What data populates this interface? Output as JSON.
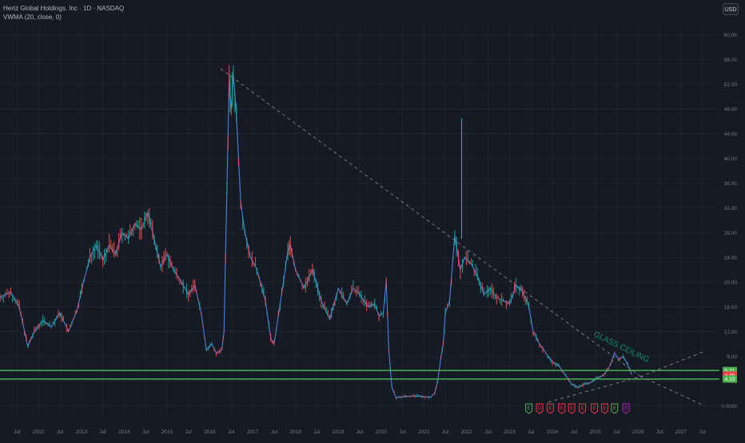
{
  "header": {
    "symbol_title": "Hertz Global Holdings, Inc · 1D · NASDAQ",
    "indicator_label": "VWMA (20, close, 0)",
    "currency_button": "USD"
  },
  "colors": {
    "background": "#161a25",
    "grid": "#1f2330",
    "axis_text": "#787b86",
    "price_line": "#4c7ee0",
    "candle_up": "#26a69a",
    "candle_down": "#ef5350",
    "support_band": "#4caf50",
    "trendline": "#787b86",
    "annotation": "#14896e",
    "badge_green": "#4caf50",
    "badge_red": "#f23645",
    "badge_purple": "#9c27b0"
  },
  "chart_data": {
    "type": "line",
    "title": "Hertz Global Holdings, Inc · 1D · NASDAQ",
    "xlabel": "",
    "ylabel": "",
    "xlim": [
      2011.1,
      2027.9
    ],
    "ylim": [
      -1.5,
      62
    ],
    "grid": true,
    "y_ticks": [
      0,
      4,
      8,
      12,
      16,
      20,
      24,
      28,
      32,
      36,
      40,
      44,
      48,
      52,
      56,
      60
    ],
    "y_tick_labels": [
      "0.0000",
      "4.00",
      "8.00",
      "12.00",
      "16.00",
      "20.00",
      "24.00",
      "28.00",
      "32.00",
      "36.00",
      "40.00",
      "44.00",
      "48.00",
      "52.00",
      "56.00",
      "60.00"
    ],
    "x_ticks": [
      {
        "x": 2011.5,
        "label": "Jul"
      },
      {
        "x": 2012.0,
        "label": "2012"
      },
      {
        "x": 2012.5,
        "label": "Jul"
      },
      {
        "x": 2013.0,
        "label": "2013"
      },
      {
        "x": 2013.5,
        "label": "Jul"
      },
      {
        "x": 2014.0,
        "label": "2014"
      },
      {
        "x": 2014.5,
        "label": "Jul"
      },
      {
        "x": 2015.0,
        "label": "2015"
      },
      {
        "x": 2015.5,
        "label": "Jul"
      },
      {
        "x": 2016.0,
        "label": "2016"
      },
      {
        "x": 2016.5,
        "label": "Jul"
      },
      {
        "x": 2017.0,
        "label": "2017"
      },
      {
        "x": 2017.5,
        "label": "Jul"
      },
      {
        "x": 2018.0,
        "label": "2018"
      },
      {
        "x": 2018.5,
        "label": "Jul"
      },
      {
        "x": 2019.0,
        "label": "2019"
      },
      {
        "x": 2019.5,
        "label": "Jul"
      },
      {
        "x": 2020.0,
        "label": "2020"
      },
      {
        "x": 2020.5,
        "label": "Jul"
      },
      {
        "x": 2021.0,
        "label": "2021"
      },
      {
        "x": 2021.5,
        "label": "Jul"
      },
      {
        "x": 2022.0,
        "label": "2022"
      },
      {
        "x": 2022.5,
        "label": "Jul"
      },
      {
        "x": 2023.0,
        "label": "2023"
      },
      {
        "x": 2023.5,
        "label": "Jul"
      },
      {
        "x": 2024.0,
        "label": "2024"
      },
      {
        "x": 2024.5,
        "label": "Jul"
      },
      {
        "x": 2025.0,
        "label": "2025"
      },
      {
        "x": 2025.5,
        "label": "Jul"
      },
      {
        "x": 2026.0,
        "label": "2026"
      },
      {
        "x": 2026.5,
        "label": "Jul"
      },
      {
        "x": 2027.0,
        "label": "2027"
      },
      {
        "x": 2027.5,
        "label": "Jul"
      }
    ],
    "series": [
      {
        "points": [
          [
            2011.1,
            17.5
          ],
          [
            2011.35,
            18.4
          ],
          [
            2011.55,
            16.0
          ],
          [
            2011.75,
            9.6
          ],
          [
            2011.9,
            12.0
          ],
          [
            2012.1,
            13.8
          ],
          [
            2012.3,
            12.8
          ],
          [
            2012.5,
            15.0
          ],
          [
            2012.7,
            12.0
          ],
          [
            2012.9,
            15.5
          ],
          [
            2013.05,
            20.0
          ],
          [
            2013.2,
            24.0
          ],
          [
            2013.35,
            26.0
          ],
          [
            2013.5,
            23.5
          ],
          [
            2013.65,
            26.0
          ],
          [
            2013.8,
            24.5
          ],
          [
            2013.95,
            28.0
          ],
          [
            2014.1,
            27.0
          ],
          [
            2014.25,
            29.5
          ],
          [
            2014.4,
            28.5
          ],
          [
            2014.55,
            31.3
          ],
          [
            2014.7,
            27.0
          ],
          [
            2014.85,
            22.5
          ],
          [
            2015.0,
            24.5
          ],
          [
            2015.15,
            22.0
          ],
          [
            2015.3,
            20.5
          ],
          [
            2015.5,
            18.0
          ],
          [
            2015.65,
            19.5
          ],
          [
            2015.8,
            15.0
          ],
          [
            2015.92,
            9.0
          ],
          [
            2016.05,
            10.0
          ],
          [
            2016.15,
            8.5
          ],
          [
            2016.28,
            9.0
          ],
          [
            2016.33,
            12.0
          ],
          [
            2016.4,
            35.0
          ],
          [
            2016.45,
            52.5
          ],
          [
            2016.5,
            48.0
          ],
          [
            2016.55,
            53.5
          ],
          [
            2016.62,
            47.0
          ],
          [
            2016.72,
            33.0
          ],
          [
            2016.82,
            28.0
          ],
          [
            2016.95,
            24.0
          ],
          [
            2017.1,
            22.0
          ],
          [
            2017.3,
            17.0
          ],
          [
            2017.42,
            11.0
          ],
          [
            2017.5,
            10.0
          ],
          [
            2017.6,
            14.5
          ],
          [
            2017.72,
            20.0
          ],
          [
            2017.82,
            25.0
          ],
          [
            2017.88,
            26.0
          ],
          [
            2018.0,
            22.0
          ],
          [
            2018.2,
            19.0
          ],
          [
            2018.4,
            22.0
          ],
          [
            2018.6,
            17.0
          ],
          [
            2018.8,
            14.0
          ],
          [
            2019.0,
            19.0
          ],
          [
            2019.2,
            16.5
          ],
          [
            2019.35,
            19.0
          ],
          [
            2019.5,
            18.0
          ],
          [
            2019.7,
            16.0
          ],
          [
            2019.85,
            16.5
          ],
          [
            2019.95,
            14.5
          ],
          [
            2020.05,
            15.0
          ],
          [
            2020.12,
            20.2
          ],
          [
            2020.18,
            9.0
          ],
          [
            2020.25,
            3.0
          ],
          [
            2020.35,
            1.3
          ],
          [
            2020.55,
            1.5
          ],
          [
            2020.75,
            1.6
          ],
          [
            2020.95,
            1.5
          ],
          [
            2021.15,
            1.4
          ],
          [
            2021.25,
            2.0
          ],
          [
            2021.32,
            4.0
          ],
          [
            2021.4,
            8.0
          ],
          [
            2021.45,
            10.0
          ],
          [
            2021.5,
            15.0
          ],
          [
            2021.6,
            17.0
          ],
          [
            2021.72,
            27.5
          ],
          [
            2021.85,
            22.0
          ],
          [
            2021.95,
            24.0
          ],
          [
            2022.1,
            23.0
          ],
          [
            2022.25,
            21.0
          ],
          [
            2022.4,
            18.0
          ],
          [
            2022.55,
            19.0
          ],
          [
            2022.7,
            17.5
          ],
          [
            2022.85,
            17.0
          ],
          [
            2023.0,
            16.5
          ],
          [
            2023.15,
            19.5
          ],
          [
            2023.3,
            18.5
          ],
          [
            2023.45,
            16.0
          ],
          [
            2023.55,
            12.0
          ],
          [
            2023.7,
            10.0
          ],
          [
            2023.85,
            8.5
          ],
          [
            2024.0,
            7.0
          ],
          [
            2024.15,
            6.5
          ],
          [
            2024.3,
            5.0
          ],
          [
            2024.45,
            3.5
          ],
          [
            2024.6,
            3.0
          ],
          [
            2024.75,
            3.5
          ],
          [
            2024.9,
            3.8
          ],
          [
            2025.05,
            4.5
          ],
          [
            2025.2,
            5.0
          ],
          [
            2025.35,
            6.5
          ],
          [
            2025.45,
            8.5
          ],
          [
            2025.55,
            7.5
          ],
          [
            2025.65,
            8.0
          ],
          [
            2025.72,
            7.2
          ],
          [
            2025.8,
            6.0
          ],
          [
            2025.85,
            5.0
          ]
        ]
      }
    ],
    "spikes": [
      {
        "x": 2021.88,
        "low": 27.0,
        "high": 46.5
      }
    ],
    "price_labels": [
      {
        "value": 5.71,
        "label": "5.71",
        "color": "#4caf50"
      },
      {
        "value": 4.95,
        "label": "4.95",
        "color": "#f23645"
      },
      {
        "value": 4.33,
        "label": "4.33",
        "color": "#4caf50"
      }
    ],
    "support_lines": [
      5.71,
      4.33
    ],
    "trendlines": [
      {
        "points": [
          [
            2016.25,
            54.5
          ],
          [
            2026.05,
            4.8
          ]
        ]
      },
      {
        "points": [
          [
            2023.9,
            0.6
          ],
          [
            2026.05,
            4.7
          ]
        ]
      },
      {
        "points": [
          [
            2026.05,
            4.8
          ],
          [
            2027.55,
            0.0
          ]
        ]
      },
      {
        "points": [
          [
            2026.05,
            4.7
          ],
          [
            2027.55,
            8.8
          ]
        ]
      }
    ],
    "annotations": [
      {
        "text": "GLASS CEILING",
        "x": 2024.95,
        "y": 11.3,
        "angle": 26
      }
    ],
    "event_markers": [
      {
        "x": 2023.45,
        "letter": "E",
        "kind": "green"
      },
      {
        "x": 2023.7,
        "letter": "D",
        "kind": "red"
      },
      {
        "x": 2023.95,
        "letter": "E",
        "kind": "red"
      },
      {
        "x": 2024.22,
        "letter": "E",
        "kind": "red"
      },
      {
        "x": 2024.45,
        "letter": "E",
        "kind": "red"
      },
      {
        "x": 2024.7,
        "letter": "E",
        "kind": "red"
      },
      {
        "x": 2024.98,
        "letter": "E",
        "kind": "red"
      },
      {
        "x": 2025.22,
        "letter": "E",
        "kind": "red"
      },
      {
        "x": 2025.45,
        "letter": "E",
        "kind": "green"
      },
      {
        "x": 2025.72,
        "letter": "E",
        "kind": "purple"
      }
    ]
  }
}
